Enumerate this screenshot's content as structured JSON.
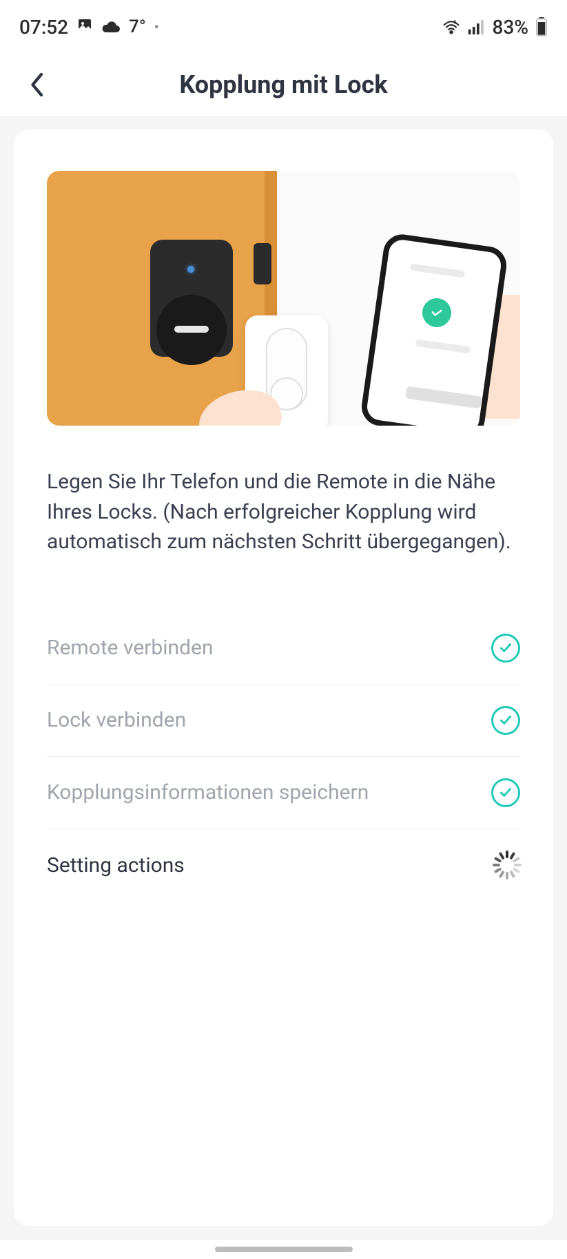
{
  "status_bar": {
    "time": "07:52",
    "temperature": "7°",
    "battery_percent": "83%"
  },
  "header": {
    "title": "Kopplung mit Lock"
  },
  "main": {
    "instruction_text": "Legen Sie Ihr Telefon und die Remote in die Nähe Ihres Locks. (Nach erfolgreicher Kopplung wird automatisch zum nächsten Schritt übergegangen).",
    "steps": [
      {
        "label": "Remote verbinden",
        "status": "done"
      },
      {
        "label": "Lock verbinden",
        "status": "done"
      },
      {
        "label": "Kopplungsinformationen speichern",
        "status": "done"
      },
      {
        "label": "Setting actions",
        "status": "loading"
      }
    ]
  },
  "colors": {
    "accent": "#1fc9b8",
    "illustration_orange": "#e8a24a"
  }
}
